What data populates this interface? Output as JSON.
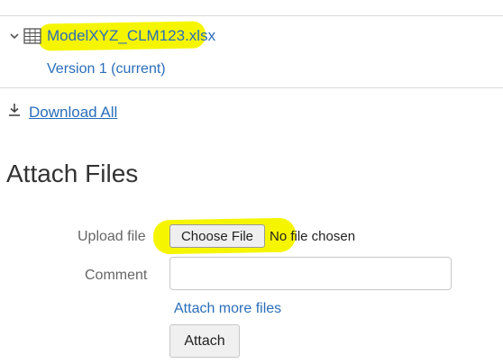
{
  "file": {
    "name": "ModelXYZ_CLM123.xlsx",
    "version_label": "Version 1 (current)"
  },
  "download_all_label": "Download All",
  "attach": {
    "heading": "Attach Files",
    "upload_label": "Upload file",
    "choose_button": "Choose File",
    "no_file_text": "No file chosen",
    "comment_label": "Comment",
    "comment_value": "",
    "attach_more": "Attach more files",
    "attach_button": "Attach"
  },
  "colors": {
    "link": "#2a6ebb",
    "highlight": "#f6f500"
  }
}
